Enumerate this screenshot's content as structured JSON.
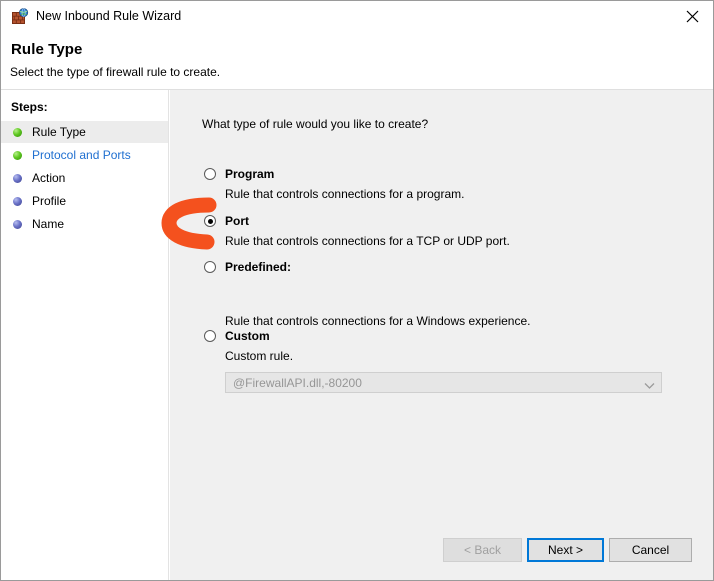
{
  "window": {
    "title": "New Inbound Rule Wizard",
    "icon": "firewall-globe-icon",
    "close_label": "✕"
  },
  "header": {
    "title": "Rule Type",
    "subtitle": "Select the type of firewall rule to create."
  },
  "sidebar": {
    "heading": "Steps:",
    "items": [
      {
        "label": "Rule Type",
        "bullet": "green",
        "state": "active"
      },
      {
        "label": "Protocol and Ports",
        "bullet": "green",
        "state": "link"
      },
      {
        "label": "Action",
        "bullet": "blue",
        "state": "normal"
      },
      {
        "label": "Profile",
        "bullet": "blue",
        "state": "normal"
      },
      {
        "label": "Name",
        "bullet": "blue",
        "state": "normal"
      }
    ]
  },
  "main": {
    "question": "What type of rule would you like to create?",
    "options": [
      {
        "title": "Program",
        "description": "Rule that controls connections for a program.",
        "selected": false
      },
      {
        "title": "Port",
        "description": "Rule that controls connections for a TCP or UDP port.",
        "selected": true
      },
      {
        "title": "Predefined:",
        "description": "Rule that controls connections for a Windows experience.",
        "selected": false
      },
      {
        "title": "Custom",
        "description": "Custom rule.",
        "selected": false
      }
    ],
    "predefined_combo": {
      "value": "@FirewallAPI.dll,-80200",
      "enabled": false
    }
  },
  "footer": {
    "back_label": "< Back",
    "next_label": "Next >",
    "cancel_label": "Cancel"
  },
  "annotation": {
    "shape": "curved-arrow-highlight",
    "color": "#F4511E",
    "points_at": "port-radio"
  },
  "colors": {
    "accent_focus": "#0078d7",
    "link": "#1f6fd0",
    "panel_bg": "#f0f0f0",
    "annotation": "#F4511E"
  }
}
